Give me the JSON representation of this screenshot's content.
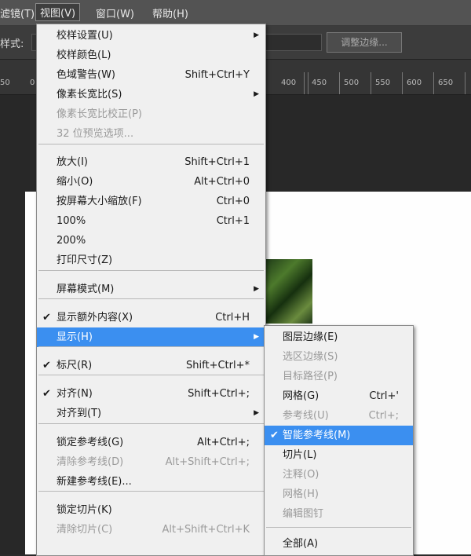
{
  "menubar": {
    "items": [
      "滤镜(T)",
      "视图(V)",
      "窗口(W)",
      "帮助(H)"
    ]
  },
  "options": {
    "style_label": "样式:",
    "refine_edge_button": "调整边缘..."
  },
  "ruler": {
    "ticks": [
      "50",
      "0",
      "400",
      "450",
      "500",
      "550",
      "600",
      "650"
    ]
  },
  "view_menu": {
    "items": [
      {
        "label": "校样设置(U)",
        "shortcut": "",
        "submenu": true
      },
      {
        "label": "校样颜色(L)",
        "shortcut": ""
      },
      {
        "label": "色域警告(W)",
        "shortcut": "Shift+Ctrl+Y"
      },
      {
        "label": "像素长宽比(S)",
        "shortcut": "",
        "submenu": true
      },
      {
        "label": "像素长宽比校正(P)",
        "shortcut": "",
        "disabled": true
      },
      {
        "label": "32 位预览选项...",
        "shortcut": "",
        "disabled": true
      },
      {
        "label": "放大(I)",
        "shortcut": "Shift+Ctrl+1"
      },
      {
        "label": "缩小(O)",
        "shortcut": "Alt+Ctrl+0"
      },
      {
        "label": "按屏幕大小缩放(F)",
        "shortcut": "Ctrl+0"
      },
      {
        "label": "100%",
        "shortcut": "Ctrl+1"
      },
      {
        "label": "200%",
        "shortcut": ""
      },
      {
        "label": "打印尺寸(Z)",
        "shortcut": ""
      },
      {
        "label": "屏幕模式(M)",
        "shortcut": "",
        "submenu": true
      },
      {
        "label": "显示额外内容(X)",
        "shortcut": "Ctrl+H",
        "checked": true
      },
      {
        "label": "显示(H)",
        "shortcut": "",
        "submenu": true,
        "highlighted": true
      },
      {
        "label": "标尺(R)",
        "shortcut": "Shift+Ctrl+*",
        "checked": true
      },
      {
        "label": "对齐(N)",
        "shortcut": "Shift+Ctrl+;",
        "checked": true
      },
      {
        "label": "对齐到(T)",
        "shortcut": "",
        "submenu": true
      },
      {
        "label": "锁定参考线(G)",
        "shortcut": "Alt+Ctrl+;"
      },
      {
        "label": "清除参考线(D)",
        "shortcut": "Alt+Shift+Ctrl+;",
        "disabled": true
      },
      {
        "label": "新建参考线(E)...",
        "shortcut": ""
      },
      {
        "label": "锁定切片(K)",
        "shortcut": ""
      },
      {
        "label": "清除切片(C)",
        "shortcut": "Alt+Shift+Ctrl+K",
        "disabled": true
      }
    ]
  },
  "show_submenu": {
    "items": [
      {
        "label": "图层边缘(E)",
        "shortcut": ""
      },
      {
        "label": "选区边缘(S)",
        "shortcut": "",
        "disabled": true
      },
      {
        "label": "目标路径(P)",
        "shortcut": "",
        "disabled": true
      },
      {
        "label": "网格(G)",
        "shortcut": "Ctrl+'"
      },
      {
        "label": "参考线(U)",
        "shortcut": "Ctrl+;",
        "disabled": true
      },
      {
        "label": "智能参考线(M)",
        "shortcut": "",
        "checked": true,
        "highlighted": true
      },
      {
        "label": "切片(L)",
        "shortcut": ""
      },
      {
        "label": "注释(O)",
        "shortcut": "",
        "disabled": true
      },
      {
        "label": "网格(H)",
        "shortcut": "",
        "disabled": true
      },
      {
        "label": "编辑图钉",
        "shortcut": "",
        "disabled": true
      },
      {
        "label": "全部(A)",
        "shortcut": ""
      }
    ]
  },
  "colors": {
    "highlight": "#3b8ff0",
    "menu_bg": "#f0f0f0",
    "app_bg": "#2b2b2b"
  }
}
